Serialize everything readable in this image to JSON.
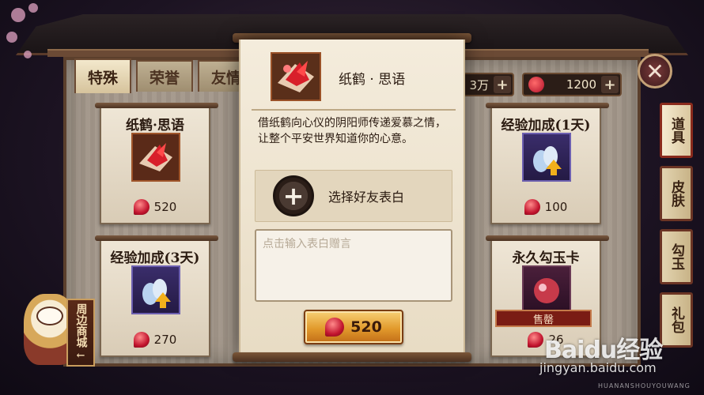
{
  "shop": {
    "tabs": [
      {
        "label": "特殊",
        "active": true
      },
      {
        "label": "荣誉",
        "active": false
      },
      {
        "label": "友情",
        "active": false
      }
    ],
    "currencies": [
      {
        "value": "3万",
        "icon": "gold-coin-icon"
      },
      {
        "value": "1200",
        "icon": "magatama-icon"
      }
    ],
    "side_tabs": [
      {
        "label": "道具",
        "active": true
      },
      {
        "label": "皮肤",
        "active": false
      },
      {
        "label": "勾玉",
        "active": false
      },
      {
        "label": "礼包",
        "active": false
      }
    ],
    "close_glyph": "✕",
    "items": [
      {
        "title": "纸鹤·思语",
        "price": "520",
        "icon": "paper-crane-icon"
      },
      {
        "title": "经验加成(1天)",
        "price": "100",
        "icon": "sake-bottles-icon"
      },
      {
        "title": "经验加成(3天)",
        "price": "270",
        "icon": "sake-bottles-icon"
      },
      {
        "title": "永久勾玉卡",
        "price": "26",
        "icon": "magatama-card-icon",
        "status": "售罄"
      }
    ],
    "bottom_left_sign": "周边商城",
    "arrow_glyph": "←"
  },
  "dialog": {
    "item_name": "纸鹤 · 思语",
    "description": "借纸鹤向心仪的阴阳师传递爱慕之情，让整个平安世界知道你的心意。",
    "select_friend_label": "选择好友表白",
    "plus_glyph": "+",
    "message_placeholder": "点击输入表白赠言",
    "message_value": "",
    "buy_price": "520"
  },
  "watermark": {
    "brand": "Baidu经验",
    "url": "jingyan.baidu.com",
    "site": "HUANANSHOUYOUWANG"
  },
  "colors": {
    "accent": "#c2142e",
    "gold_button": "#e29a2c",
    "panel": "#a3978a",
    "scroll": "#f4ecdc"
  }
}
